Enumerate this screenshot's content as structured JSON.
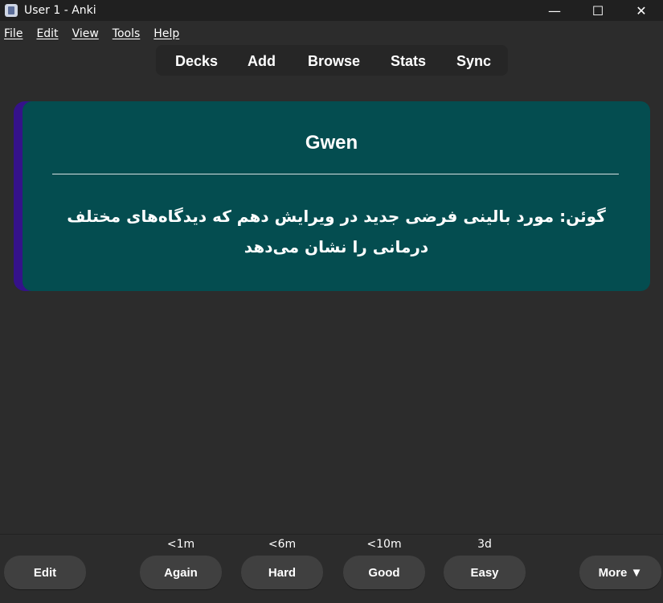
{
  "window": {
    "title": "User 1 - Anki",
    "controls": {
      "minimize": "—",
      "maximize": "☐",
      "close": "✕"
    }
  },
  "menu": [
    "File",
    "Edit",
    "View",
    "Tools",
    "Help"
  ],
  "nav": [
    "Decks",
    "Add",
    "Browse",
    "Stats",
    "Sync"
  ],
  "card": {
    "front": "Gwen",
    "back": "گوئن: مورد بالینی فرضی جدید در ویرایش دهم که دیدگاه‌های مختلف درمانی را نشان می‌دهد",
    "colors": {
      "card_bg": "#044d50",
      "accent": "#35128a"
    }
  },
  "answer_bar": {
    "edit_label": "Edit",
    "more_label": "More ▼",
    "buttons": [
      {
        "label": "Again",
        "interval": "<1m"
      },
      {
        "label": "Hard",
        "interval": "<6m"
      },
      {
        "label": "Good",
        "interval": "<10m"
      },
      {
        "label": "Easy",
        "interval": "3d"
      }
    ]
  }
}
